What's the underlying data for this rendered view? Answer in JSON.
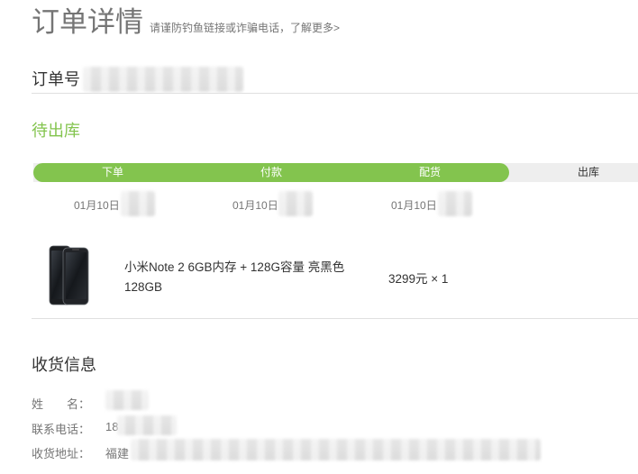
{
  "header": {
    "title": "订单详情",
    "hint": "请谨防钓鱼链接或诈骗电话，了解更多>"
  },
  "order": {
    "number_label": "订单号"
  },
  "status": {
    "text": "待出库",
    "accent_color": "#83c44e"
  },
  "progress": {
    "steps": [
      {
        "label": "下单",
        "done": true,
        "date": "01月10日"
      },
      {
        "label": "付款",
        "done": true,
        "date": "01月10日"
      },
      {
        "label": "配货",
        "done": true,
        "date": "01月10日"
      },
      {
        "label": "出库",
        "done": false,
        "date": ""
      }
    ],
    "completed_fraction": 0.75
  },
  "product": {
    "name": "小米Note 2 6GB内存 + 128G容量 亮黑色 128GB",
    "price_qty": "3299元 × 1",
    "image_icon": "phone-icon"
  },
  "shipping": {
    "section_title": "收货信息",
    "name_label": "姓　　名：",
    "phone_label": "联系电话：",
    "phone_visible": "18",
    "address_label": "收货地址：",
    "address_visible": "福建"
  }
}
